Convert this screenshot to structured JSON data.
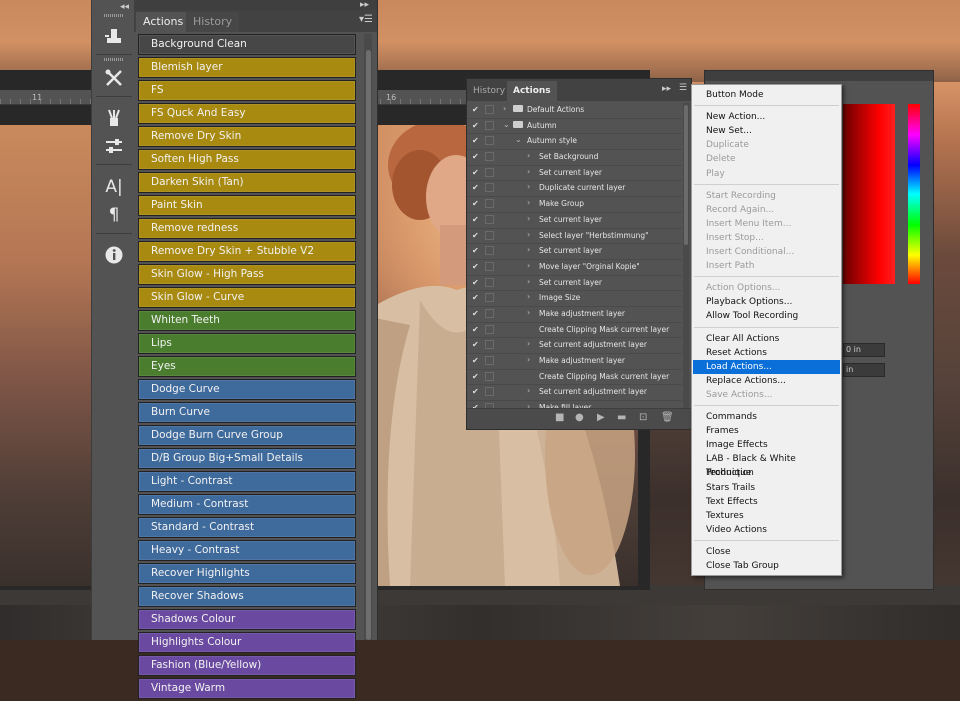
{
  "ruler": {
    "marks": [
      "11",
      "16"
    ]
  },
  "toolstrip": {
    "tools": [
      "actions-tool-icon",
      "tools-icon",
      "brush-presets-icon",
      "adjustments-icon",
      "character-icon",
      "paragraph-icon",
      "info-icon"
    ]
  },
  "actions_panel": {
    "tabs": [
      "Actions",
      "History"
    ],
    "buttons": [
      {
        "label": "Background Clean",
        "color": "#474747"
      },
      {
        "label": "Blemish layer",
        "color": "#a88a10"
      },
      {
        "label": "FS",
        "color": "#a88a10"
      },
      {
        "label": "FS Quck And Easy",
        "color": "#a88a10"
      },
      {
        "label": "Remove Dry Skin",
        "color": "#a88a10"
      },
      {
        "label": "Soften High Pass",
        "color": "#a88a10"
      },
      {
        "label": "Darken Skin (Tan)",
        "color": "#a88a10"
      },
      {
        "label": "Paint Skin",
        "color": "#a88a10"
      },
      {
        "label": "Remove redness",
        "color": "#a88a10"
      },
      {
        "label": "Remove Dry Skin + Stubble V2",
        "color": "#a88a10"
      },
      {
        "label": "Skin Glow - High Pass",
        "color": "#a88a10"
      },
      {
        "label": "Skin Glow - Curve",
        "color": "#a88a10"
      },
      {
        "label": "Whiten Teeth",
        "color": "#4b7d2f"
      },
      {
        "label": "Lips",
        "color": "#4b7d2f"
      },
      {
        "label": "Eyes",
        "color": "#4b7d2f"
      },
      {
        "label": "Dodge Curve",
        "color": "#3f6a9c"
      },
      {
        "label": "Burn Curve",
        "color": "#3f6a9c"
      },
      {
        "label": "Dodge Burn Curve Group",
        "color": "#3f6a9c"
      },
      {
        "label": "D/B Group Big+Small Details",
        "color": "#3f6a9c"
      },
      {
        "label": "Light - Contrast",
        "color": "#3f6a9c"
      },
      {
        "label": "Medium - Contrast",
        "color": "#3f6a9c"
      },
      {
        "label": "Standard - Contrast",
        "color": "#3f6a9c"
      },
      {
        "label": "Heavy - Contrast",
        "color": "#3f6a9c"
      },
      {
        "label": "Recover Highlights",
        "color": "#3f6a9c"
      },
      {
        "label": "Recover Shadows",
        "color": "#3f6a9c"
      },
      {
        "label": "Shadows Colour",
        "color": "#6a4aa0"
      },
      {
        "label": "Highlights Colour",
        "color": "#6a4aa0"
      },
      {
        "label": "Fashion (Blue/Yellow)",
        "color": "#6a4aa0"
      },
      {
        "label": "Vintage Warm",
        "color": "#6a4aa0"
      }
    ]
  },
  "list_panel": {
    "tabs": [
      "History",
      "Actions"
    ],
    "rows": [
      {
        "label": "Default Actions",
        "level": 0,
        "folder": true,
        "expanded": false
      },
      {
        "label": "Autumn",
        "level": 0,
        "folder": true,
        "expanded": true
      },
      {
        "label": "Autumn style",
        "level": 1,
        "folder": false,
        "expanded": true
      },
      {
        "label": "Set Background",
        "level": 2,
        "folder": false,
        "expanded": false
      },
      {
        "label": "Set current layer",
        "level": 2,
        "folder": false,
        "expanded": false
      },
      {
        "label": "Duplicate current layer",
        "level": 2,
        "folder": false,
        "expanded": false
      },
      {
        "label": "Make Group",
        "level": 2,
        "folder": false,
        "expanded": false
      },
      {
        "label": "Set current layer",
        "level": 2,
        "folder": false,
        "expanded": false
      },
      {
        "label": "Select layer \"Herbstimmung\"",
        "level": 2,
        "folder": false,
        "expanded": false
      },
      {
        "label": "Set current layer",
        "level": 2,
        "folder": false,
        "expanded": false
      },
      {
        "label": "Move layer \"Orginal Kopie\"",
        "level": 2,
        "folder": false,
        "expanded": false
      },
      {
        "label": "Set current layer",
        "level": 2,
        "folder": false,
        "expanded": false
      },
      {
        "label": "Image Size",
        "level": 2,
        "folder": false,
        "expanded": false
      },
      {
        "label": "Make adjustment layer",
        "level": 2,
        "folder": false,
        "expanded": false
      },
      {
        "label": "Create Clipping Mask current layer",
        "level": 2,
        "folder": false,
        "expanded": null
      },
      {
        "label": "Set current adjustment layer",
        "level": 2,
        "folder": false,
        "expanded": false
      },
      {
        "label": "Make adjustment layer",
        "level": 2,
        "folder": false,
        "expanded": false
      },
      {
        "label": "Create Clipping Mask current layer",
        "level": 2,
        "folder": false,
        "expanded": null
      },
      {
        "label": "Set current adjustment layer",
        "level": 2,
        "folder": false,
        "expanded": false
      },
      {
        "label": "Make fill layer",
        "level": 2,
        "folder": false,
        "expanded": false
      },
      {
        "label": "Move current layer",
        "level": 2,
        "folder": false,
        "expanded": false
      }
    ],
    "footer_icons": [
      "stop-icon",
      "record-icon",
      "play-icon",
      "new-set-icon",
      "new-action-icon",
      "delete-icon"
    ]
  },
  "right_panel": {
    "field1": "0 in",
    "field2": "in"
  },
  "menu": {
    "highlighted": "Load Actions...",
    "groups": [
      [
        {
          "label": "Button Mode",
          "disabled": false
        }
      ],
      [
        {
          "label": "New Action...",
          "disabled": false
        },
        {
          "label": "New Set...",
          "disabled": false
        },
        {
          "label": "Duplicate",
          "disabled": true
        },
        {
          "label": "Delete",
          "disabled": true
        },
        {
          "label": "Play",
          "disabled": true
        }
      ],
      [
        {
          "label": "Start Recording",
          "disabled": true
        },
        {
          "label": "Record Again...",
          "disabled": true
        },
        {
          "label": "Insert Menu Item...",
          "disabled": true
        },
        {
          "label": "Insert Stop...",
          "disabled": true
        },
        {
          "label": "Insert Conditional...",
          "disabled": true
        },
        {
          "label": "Insert Path",
          "disabled": true
        }
      ],
      [
        {
          "label": "Action Options...",
          "disabled": true
        },
        {
          "label": "Playback Options...",
          "disabled": false
        },
        {
          "label": "Allow Tool Recording",
          "disabled": false
        }
      ],
      [
        {
          "label": "Clear All Actions",
          "disabled": false
        },
        {
          "label": "Reset Actions",
          "disabled": false
        },
        {
          "label": "Load Actions...",
          "disabled": false
        },
        {
          "label": "Replace Actions...",
          "disabled": false
        },
        {
          "label": "Save Actions...",
          "disabled": true
        }
      ],
      [
        {
          "label": "Commands",
          "disabled": false
        },
        {
          "label": "Frames",
          "disabled": false
        },
        {
          "label": "Image Effects",
          "disabled": false
        },
        {
          "label": "LAB - Black & White Technique",
          "disabled": false
        },
        {
          "label": "Production",
          "disabled": false
        },
        {
          "label": "Stars Trails",
          "disabled": false
        },
        {
          "label": "Text Effects",
          "disabled": false
        },
        {
          "label": "Textures",
          "disabled": false
        },
        {
          "label": "Video Actions",
          "disabled": false
        }
      ],
      [
        {
          "label": "Close",
          "disabled": false
        },
        {
          "label": "Close Tab Group",
          "disabled": false
        }
      ]
    ]
  }
}
